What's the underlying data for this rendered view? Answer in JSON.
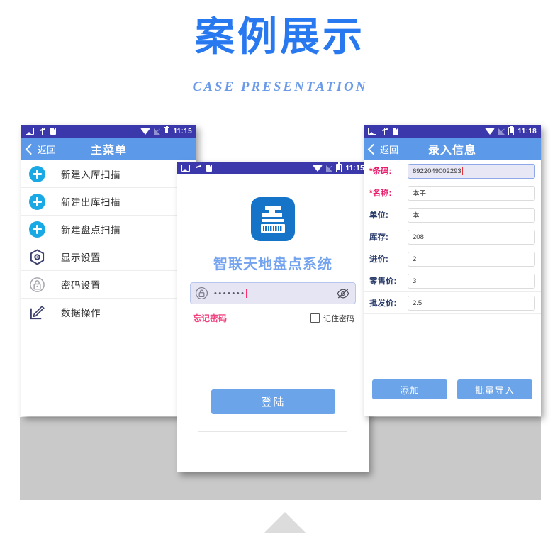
{
  "header": {
    "title_cn": "案例展示",
    "title_en": "CASE  PRESENTATION",
    "accent_color": "#2878f0",
    "subtitle_color": "#6a9ae8"
  },
  "phone_menu": {
    "statusbar": {
      "time": "11:15",
      "left_icons": [
        "image-icon",
        "usb-icon",
        "document-icon"
      ],
      "right_icons": [
        "wifi-icon",
        "signal-off-icon",
        "battery-icon"
      ]
    },
    "titlebar": {
      "back_label": "返回",
      "title": "主菜单"
    },
    "items": [
      {
        "icon": "plus-circle-icon",
        "label": "新建入库扫描"
      },
      {
        "icon": "plus-circle-icon",
        "label": "新建出库扫描"
      },
      {
        "icon": "plus-circle-icon",
        "label": "新建盘点扫描"
      },
      {
        "icon": "hexagon-gear-icon",
        "label": "显示设置"
      },
      {
        "icon": "lock-circle-icon",
        "label": "密码设置"
      },
      {
        "icon": "edit-pencil-icon",
        "label": "数据操作"
      }
    ]
  },
  "phone_login": {
    "statusbar": {
      "time": "11:15"
    },
    "app_title": "智联天地盘点系统",
    "password": {
      "icon": "lock-icon",
      "value": "•••••••",
      "toggle_icon": "eye-slash-icon"
    },
    "forgot_label": "忘记密码",
    "remember_label": "记住密码",
    "remember_checked": false,
    "login_label": "登陆"
  },
  "phone_form": {
    "statusbar": {
      "time": "11:18"
    },
    "titlebar": {
      "back_label": "返回",
      "title": "录入信息"
    },
    "fields": [
      {
        "required": true,
        "label": "条码:",
        "value": "6922049002293",
        "focused": true
      },
      {
        "required": true,
        "label": "名称:",
        "value": "本子",
        "focused": false
      },
      {
        "required": false,
        "label": "单位:",
        "value": "本",
        "focused": false
      },
      {
        "required": false,
        "label": "库存:",
        "value": "208",
        "focused": false
      },
      {
        "required": false,
        "label": "进价:",
        "value": "2",
        "focused": false
      },
      {
        "required": false,
        "label": "零售价:",
        "value": "3",
        "focused": false
      },
      {
        "required": false,
        "label": "批发价:",
        "value": "2.5",
        "focused": false
      }
    ],
    "actions": [
      {
        "label": "添加"
      },
      {
        "label": "批量导入"
      }
    ]
  },
  "decor": {
    "band_color": "#c9c9c9",
    "arrow_color": "#dcdcdc"
  }
}
